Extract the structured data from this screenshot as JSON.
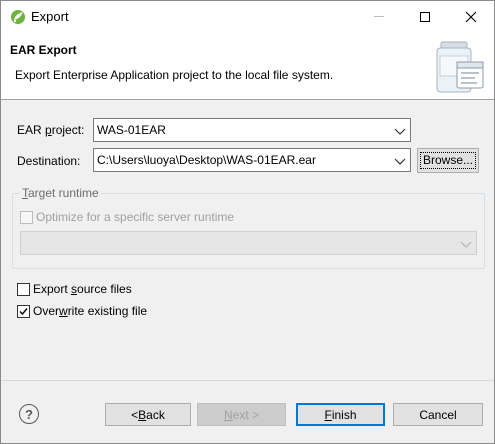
{
  "window": {
    "title": "Export",
    "icon": "eclipse-spring-icon"
  },
  "banner": {
    "title": "EAR Export",
    "description": "Export Enterprise Application project to the local file system.",
    "image": "jar-archive-icon"
  },
  "form": {
    "project_label_pre": "EAR ",
    "project_label_ul": "p",
    "project_label_post": "roject:",
    "project_value": "WAS-01EAR",
    "destination_label": "Destination:",
    "destination_value": "C:\\Users\\luoya\\Desktop\\WAS-01EAR.ear",
    "browse_label": "Browse..."
  },
  "target_runtime": {
    "legend_ul": "T",
    "legend_post": "arget runtime",
    "optimize_label": "Optimize for a specific server runtime",
    "optimize_checked": false,
    "runtime_value": ""
  },
  "options": {
    "export_source_pre": "Export ",
    "export_source_ul": "s",
    "export_source_post": "ource files",
    "export_source_checked": false,
    "overwrite_pre": "Over",
    "overwrite_ul": "w",
    "overwrite_post": "rite existing file",
    "overwrite_checked": true
  },
  "footer": {
    "back_pre": "< ",
    "back_ul": "B",
    "back_post": "ack",
    "next_ul": "N",
    "next_post": "ext >",
    "finish_ul": "F",
    "finish_post": "inish",
    "cancel_label": "Cancel",
    "help_glyph": "?"
  },
  "colors": {
    "accent": "#0078d7",
    "disabled_text": "#a0a0a0"
  }
}
